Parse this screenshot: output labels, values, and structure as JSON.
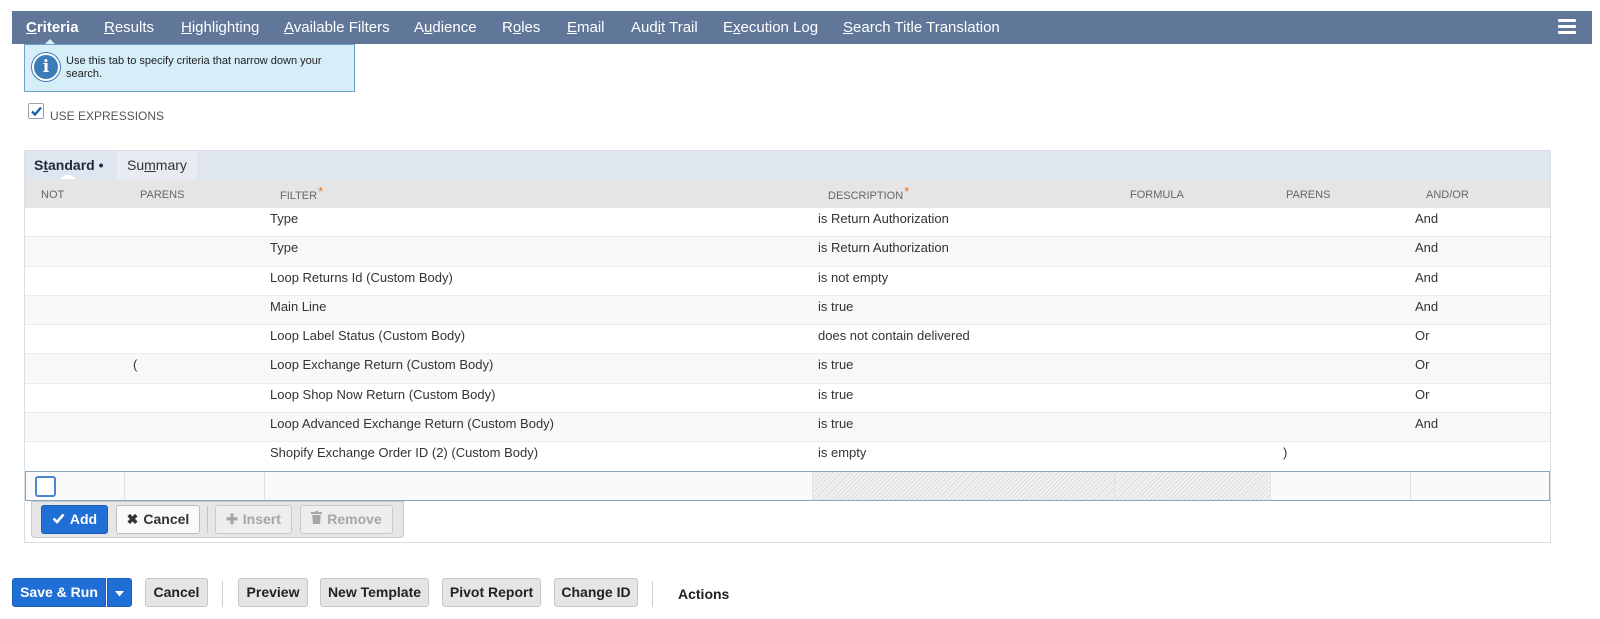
{
  "tabs": [
    {
      "label": "Criteria",
      "key": "C",
      "rest": "riteria",
      "active": true
    },
    {
      "label": "Results",
      "key": "R",
      "rest": "esults"
    },
    {
      "label": "Highlighting",
      "key": "H",
      "rest": "ighlighting"
    },
    {
      "label": "Available Filters",
      "key": "A",
      "rest": "vailable Filters"
    },
    {
      "label": "Audience",
      "pre": "A",
      "key": "u",
      "rest": "dience"
    },
    {
      "label": "Roles",
      "pre": "R",
      "key": "o",
      "rest": "les"
    },
    {
      "label": "Email",
      "key": "E",
      "rest": "mail"
    },
    {
      "label": "Audit Trail",
      "pre": "Aud",
      "key": "i",
      "rest": "t Trail"
    },
    {
      "label": "Execution Log",
      "pre": "E",
      "key": "x",
      "rest": "ecution Log"
    },
    {
      "label": "Search Title Translation",
      "key": "S",
      "rest": "earch Title Translation"
    }
  ],
  "info_text": "Use this tab to specify criteria that narrow down your search.",
  "use_expressions": {
    "label": "USE EXPRESSIONS",
    "checked": true
  },
  "subtabs": {
    "standard": {
      "pre": "S",
      "key": "t",
      "rest": "andard",
      "dot": "•"
    },
    "summary": {
      "pre": "Su",
      "key": "m",
      "rest": "mary"
    }
  },
  "columns": {
    "not": "NOT",
    "parens_open": "PARENS",
    "filter": "FILTER",
    "description": "DESCRIPTION",
    "formula": "FORMULA",
    "parens_close": "PARENS",
    "andor": "AND/OR",
    "required_mark": "*"
  },
  "rows": [
    {
      "not": "",
      "open": "",
      "filter": "Type",
      "description": "is Return Authorization",
      "formula": "",
      "close": "",
      "andor": "And"
    },
    {
      "not": "",
      "open": "",
      "filter": "Type",
      "description": "is Return Authorization",
      "formula": "",
      "close": "",
      "andor": "And"
    },
    {
      "not": "",
      "open": "",
      "filter": "Loop Returns Id (Custom Body)",
      "description": "is not empty",
      "formula": "",
      "close": "",
      "andor": "And"
    },
    {
      "not": "",
      "open": "",
      "filter": "Main Line",
      "description": "is true",
      "formula": "",
      "close": "",
      "andor": "And"
    },
    {
      "not": "",
      "open": "",
      "filter": "Loop Label Status (Custom Body)",
      "description": "does not contain delivered",
      "formula": "",
      "close": "",
      "andor": "Or"
    },
    {
      "not": "",
      "open": "(",
      "filter": "Loop Exchange Return (Custom Body)",
      "description": "is true",
      "formula": "",
      "close": "",
      "andor": "Or"
    },
    {
      "not": "",
      "open": "",
      "filter": "Loop Shop Now Return (Custom Body)",
      "description": "is true",
      "formula": "",
      "close": "",
      "andor": "Or"
    },
    {
      "not": "",
      "open": "",
      "filter": "Loop Advanced Exchange Return (Custom Body)",
      "description": "is true",
      "formula": "",
      "close": "",
      "andor": "And"
    },
    {
      "not": "",
      "open": "",
      "filter": "Shopify Exchange Order ID (2) (Custom Body)",
      "description": "is empty",
      "formula": "",
      "close": ")",
      "andor": ""
    }
  ],
  "row_buttons": {
    "add": "Add",
    "cancel": "Cancel",
    "insert": "Insert",
    "remove": "Remove"
  },
  "footer": {
    "save_run": "Save & Run",
    "cancel": "Cancel",
    "preview": "Preview",
    "new_template": "New Template",
    "pivot_report": "Pivot Report",
    "change_id": "Change ID",
    "actions": "Actions"
  },
  "colors": {
    "tabbar": "#607799",
    "info_bg": "#d5eef8",
    "primary": "#1f6fd6"
  },
  "icons": [
    "info-icon",
    "menu-icon",
    "check-icon",
    "close-icon",
    "plus-icon",
    "trash-icon",
    "caret-down-icon"
  ]
}
